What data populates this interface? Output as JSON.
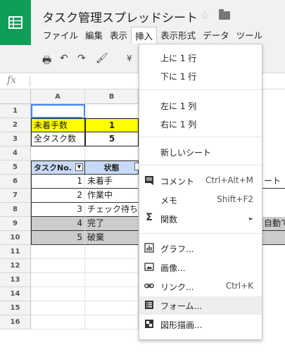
{
  "app": {
    "title": "タスク管理スプレッドシート",
    "star": "☆"
  },
  "menubar": [
    {
      "label": "ファイル"
    },
    {
      "label": "編集"
    },
    {
      "label": "表示"
    },
    {
      "label": "挿入",
      "active": true
    },
    {
      "label": "表示形式"
    },
    {
      "label": "データ"
    },
    {
      "label": "ツール"
    }
  ],
  "toolbar": {
    "print": "🖶",
    "undo": "↶",
    "redo": "↷",
    "paint_format": "🖌",
    "currency": "¥"
  },
  "formula_bar": {
    "fx_label": "fx",
    "value": ""
  },
  "columns": [
    {
      "label": "A"
    },
    {
      "label": "B"
    }
  ],
  "rows": [
    "1",
    "2",
    "3",
    "4",
    "5",
    "6",
    "7",
    "8",
    "9",
    "10",
    "11",
    "12",
    "13",
    "14",
    "15",
    "16"
  ],
  "cells": {
    "a2": "未着手数",
    "b2": "1",
    "a3": "全タスク数",
    "b3": "5",
    "a5": "タスクNo.",
    "b5": "状態",
    "a6": "1",
    "b6": "未着手",
    "a7": "2",
    "b7": "作業中",
    "a8": "3",
    "b8": "チェック待ち",
    "a9": "4",
    "b9": "完了",
    "a10": "5",
    "b10": "破棄",
    "c6_overflow": "ート",
    "c9_overflow": "自動で"
  },
  "colors": {
    "brand_green": "#0f9d58",
    "yellow": "#ffff00",
    "header_blue": "#c9daf8",
    "gray_row": "#cccccc",
    "selection": "#4285f4"
  },
  "insert_menu": {
    "items": [
      {
        "label": "上に 1 行"
      },
      {
        "label": "下に 1 行"
      },
      {
        "label": "左に 1 列"
      },
      {
        "label": "右に 1 列"
      },
      {
        "label": "新しいシート"
      },
      {
        "label": "コメント",
        "shortcut": "Ctrl+Alt+M",
        "icon": "comment-icon"
      },
      {
        "label": "メモ",
        "shortcut": "Shift+F2"
      },
      {
        "label": "関数",
        "shortcut": "►",
        "icon": "sigma-icon"
      },
      {
        "label": "グラフ...",
        "icon": "chart-icon"
      },
      {
        "label": "画像...",
        "icon": "image-icon"
      },
      {
        "label": "リンク...",
        "shortcut": "Ctrl+K",
        "icon": "link-icon"
      },
      {
        "label": "フォーム...",
        "icon": "form-icon"
      },
      {
        "label": "図形描画...",
        "icon": "drawing-icon"
      }
    ]
  }
}
